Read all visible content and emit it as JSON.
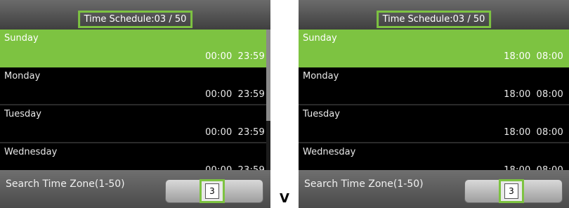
{
  "separator": "V",
  "screens": [
    {
      "title": "Time Schedule:03 / 50",
      "rows": [
        {
          "day": "Sunday",
          "start": "00:00",
          "end": "23:59"
        },
        {
          "day": "Monday",
          "start": "00:00",
          "end": "23:59"
        },
        {
          "day": "Tuesday",
          "start": "00:00",
          "end": "23:59"
        },
        {
          "day": "Wednesday",
          "start": "00:00",
          "end": "23:59"
        }
      ],
      "footer": {
        "label": "Search Time Zone(1-50)",
        "value": "3"
      }
    },
    {
      "title": "Time Schedule:03 / 50",
      "rows": [
        {
          "day": "Sunday",
          "start": "18:00",
          "end": "08:00"
        },
        {
          "day": "Monday",
          "start": "18:00",
          "end": "08:00"
        },
        {
          "day": "Tuesday",
          "start": "18:00",
          "end": "08:00"
        },
        {
          "day": "Wednesday",
          "start": "18:00",
          "end": "08:00"
        }
      ],
      "footer": {
        "label": "Search Time Zone(1-50)",
        "value": "3"
      }
    }
  ],
  "colors": {
    "accent": "#7dc341",
    "background": "#000000"
  }
}
